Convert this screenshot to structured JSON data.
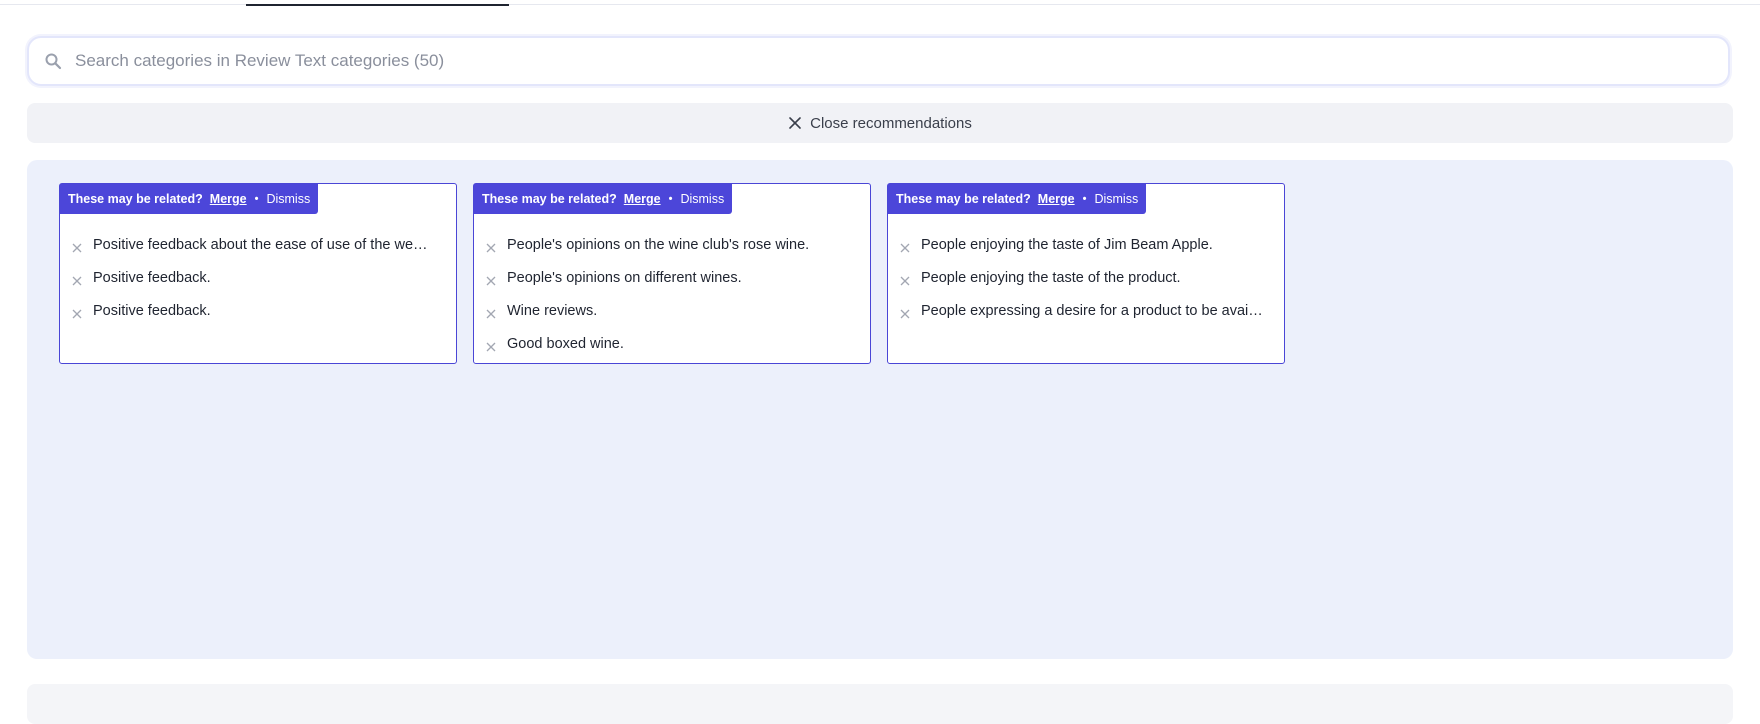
{
  "search": {
    "placeholder": "Search categories in Review Text categories (50)",
    "value": ""
  },
  "recommendations": {
    "close_label": "Close recommendations",
    "groups": [
      {
        "prompt": "These may be related?",
        "merge_label": "Merge",
        "dismiss_label": "Dismiss",
        "items": [
          "Positive feedback about the ease of use of the we…",
          "Positive feedback.",
          "Positive feedback."
        ]
      },
      {
        "prompt": "These may be related?",
        "merge_label": "Merge",
        "dismiss_label": "Dismiss",
        "items": [
          "People's opinions on the wine club's rose wine.",
          "People's opinions on different wines.",
          "Wine reviews.",
          "Good boxed wine."
        ]
      },
      {
        "prompt": "These may be related?",
        "merge_label": "Merge",
        "dismiss_label": "Dismiss",
        "items": [
          "People enjoying the taste of Jim Beam Apple.",
          "People enjoying the taste of the product.",
          "People expressing a desire for a product to be avai…"
        ]
      }
    ]
  },
  "colors": {
    "accent": "#4c46d9",
    "panel_bg": "#ecf0fb"
  }
}
